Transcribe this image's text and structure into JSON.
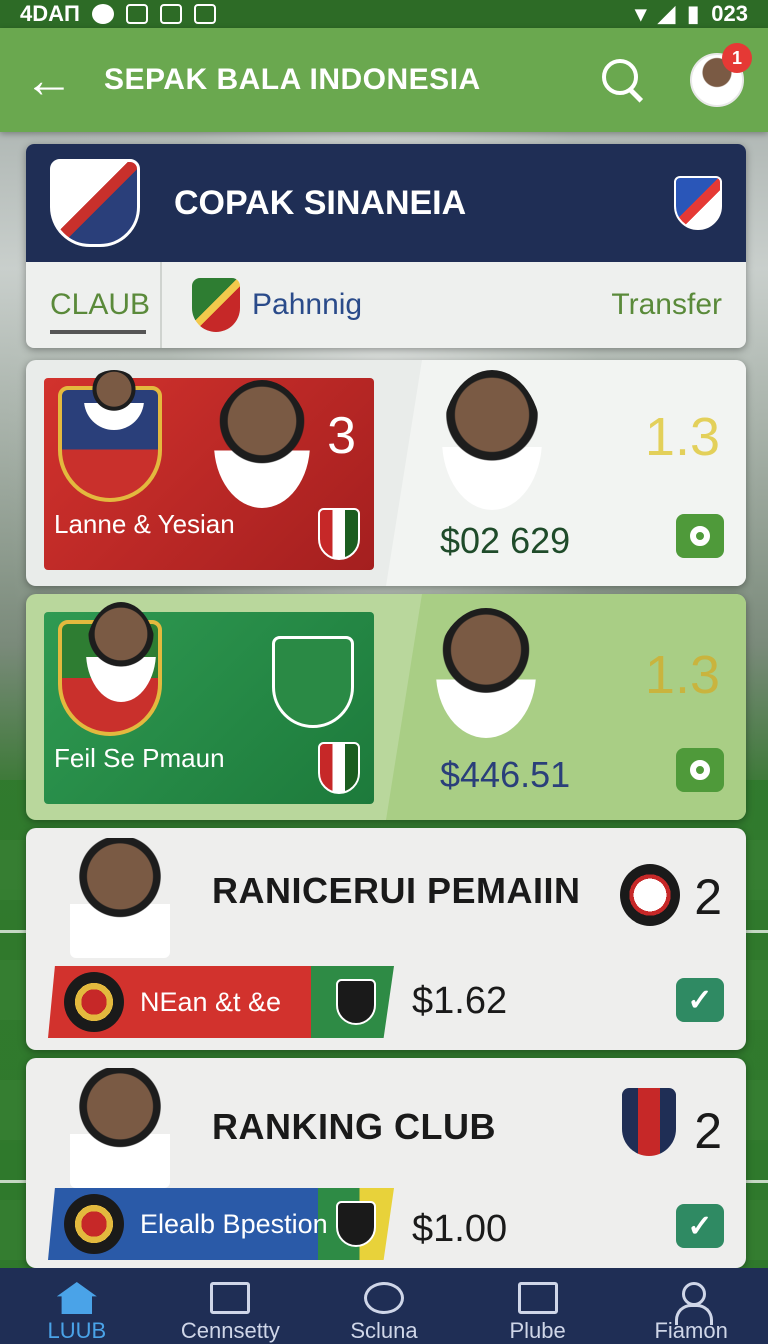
{
  "status_bar": {
    "left_text": "4DAΠ",
    "time": "023"
  },
  "header": {
    "title": "SEPAK BALA INDONESIA",
    "notification_count": "1"
  },
  "league": {
    "name": "COPAK SINANEIA",
    "tabs": {
      "active": "CLAUB",
      "middle": "Pahnnig",
      "right": "Transfer"
    }
  },
  "matches": [
    {
      "team": "Lanne & Yesian",
      "score": "3",
      "odds": "1.3",
      "price": "$02 629"
    },
    {
      "team": "Feil Se Pmaun",
      "score": "",
      "odds": "1.3",
      "price": "$446.51"
    }
  ],
  "rankings": [
    {
      "title": "RANICERUI PEMAIIN",
      "rank": "2",
      "club": "NEan &t &e",
      "price": "$1.62"
    },
    {
      "title": "RANKING CLUB",
      "rank": "2",
      "club": "Elealb Bpestion",
      "price": "$1.00"
    }
  ],
  "bottom_nav": [
    {
      "label": "LUUB",
      "icon": "home-icon",
      "active": true
    },
    {
      "label": "Cennsetty",
      "icon": "document-icon",
      "active": false
    },
    {
      "label": "Scluna",
      "icon": "compass-icon",
      "active": false
    },
    {
      "label": "Plube",
      "icon": "edit-icon",
      "active": false
    },
    {
      "label": "Fiamon",
      "icon": "person-icon",
      "active": false
    }
  ],
  "colors": {
    "header_green": "#6aa84f",
    "navy": "#1f2e55",
    "accent_blue": "#4aa3e8"
  }
}
